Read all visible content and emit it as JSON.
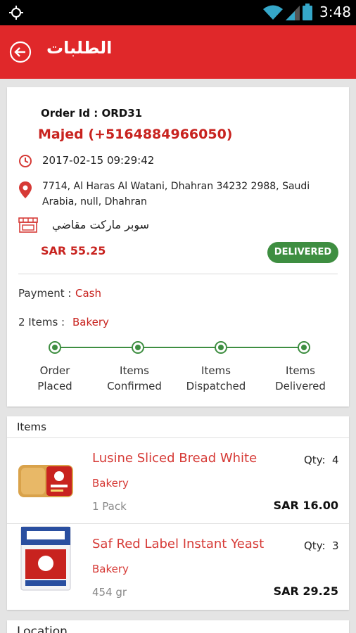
{
  "status_bar": {
    "time": "3:48"
  },
  "app_bar": {
    "title": "الطلبات"
  },
  "order": {
    "id_label": "Order Id :",
    "id_value": "ORD31",
    "customer": "Majed (+5164884966050)",
    "datetime": "2017-02-15 09:29:42",
    "address": "7714, Al Haras Al Watani, Dhahran 34232 2988, Saudi Arabia, null, Dhahran",
    "store": "سوبر ماركت مقاضي",
    "amount": "SAR  55.25",
    "status": "DELIVERED",
    "payment_label": "Payment :",
    "payment_value": "Cash",
    "items_label": "2 Items :",
    "items_value": "Bakery",
    "steps": [
      {
        "line1": "Order",
        "line2": "Placed"
      },
      {
        "line1": "Items",
        "line2": "Confirmed"
      },
      {
        "line1": "Items",
        "line2": "Dispatched"
      },
      {
        "line1": "Items",
        "line2": "Delivered"
      }
    ]
  },
  "items_section": {
    "title": "Items",
    "qty_label": "Qty:",
    "items": [
      {
        "name": "Lusine Sliced Bread White",
        "category": "Bakery",
        "unit": "1 Pack",
        "qty": "4",
        "price": "SAR  16.00"
      },
      {
        "name": "Saf Red Label Instant Yeast",
        "category": "Bakery",
        "unit": "454 gr",
        "qty": "3",
        "price": "SAR  29.25"
      }
    ]
  },
  "location_section": {
    "title": "Location"
  },
  "colors": {
    "accent": "#e0282a",
    "status_green": "#3e8e41",
    "text_red": "#c8231f"
  }
}
